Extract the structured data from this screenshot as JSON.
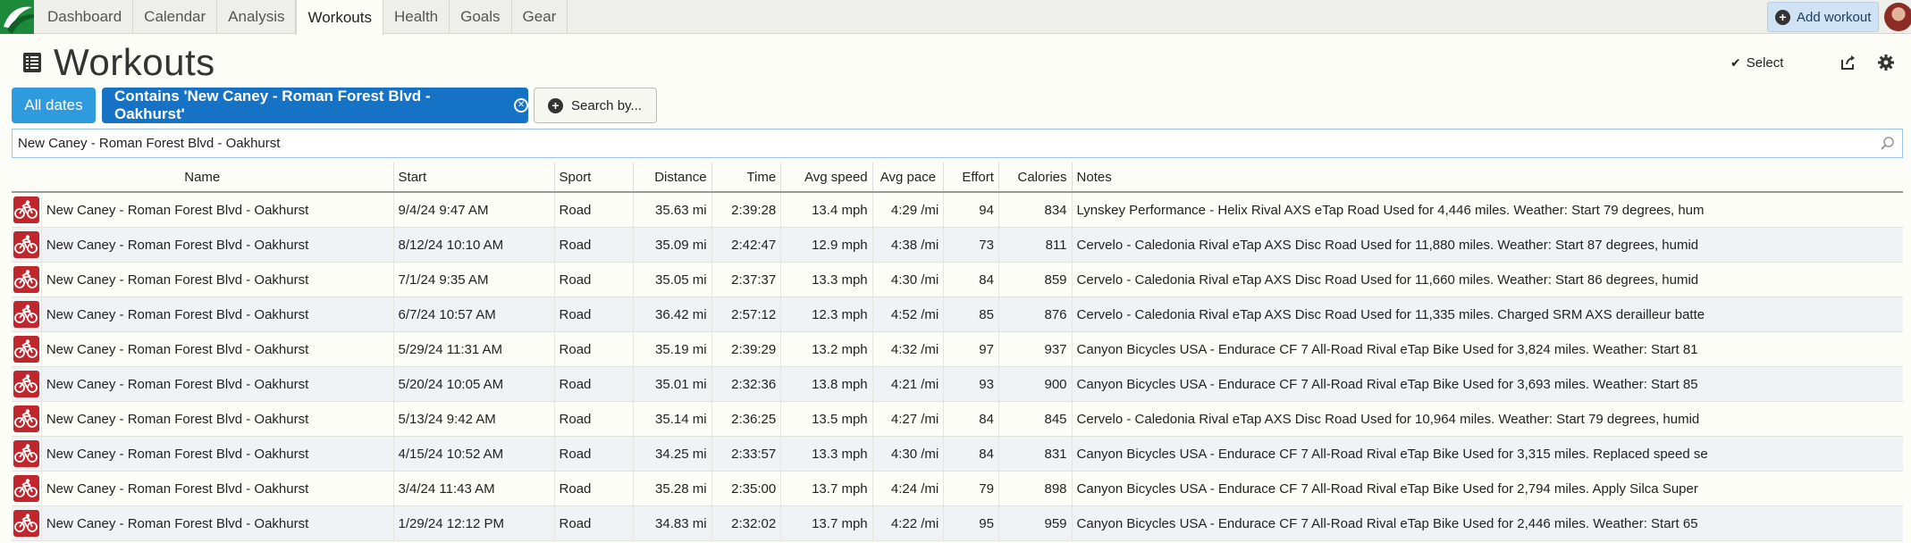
{
  "nav": {
    "tabs": [
      {
        "label": "Dashboard"
      },
      {
        "label": "Calendar"
      },
      {
        "label": "Analysis"
      },
      {
        "label": "Workouts"
      },
      {
        "label": "Health"
      },
      {
        "label": "Goals"
      },
      {
        "label": "Gear"
      }
    ],
    "active_tab": "Workouts",
    "add_workout_label": "Add workout"
  },
  "page": {
    "title": "Workouts",
    "select_label": "Select"
  },
  "filters": {
    "dates_label": "All dates",
    "contains_label": "Contains 'New Caney - Roman Forest Blvd - Oakhurst'",
    "search_by_label": "Search by..."
  },
  "search": {
    "value": "New Caney - Roman Forest Blvd - Oakhurst"
  },
  "table": {
    "headers": {
      "name": "Name",
      "start": "Start",
      "sport": "Sport",
      "distance": "Distance",
      "time": "Time",
      "avg_speed": "Avg speed",
      "avg_pace": "Avg pace",
      "effort": "Effort",
      "calories": "Calories",
      "notes": "Notes"
    },
    "rows": [
      {
        "name": "New Caney - Roman Forest Blvd - Oakhurst",
        "start": "9/4/24 9:47 AM",
        "sport": "Road",
        "distance": "35.63 mi",
        "time": "2:39:28",
        "avg_speed": "13.4 mph",
        "avg_pace": "4:29 /mi",
        "effort": "94",
        "calories": "834",
        "notes": "Lynskey Performance - Helix Rival AXS eTap Road Used for 4,446 miles. Weather: Start 79 degrees, hum"
      },
      {
        "name": "New Caney - Roman Forest Blvd - Oakhurst",
        "start": "8/12/24 10:10 AM",
        "sport": "Road",
        "distance": "35.09 mi",
        "time": "2:42:47",
        "avg_speed": "12.9 mph",
        "avg_pace": "4:38 /mi",
        "effort": "73",
        "calories": "811",
        "notes": "Cervelo - Caledonia Rival eTap AXS Disc Road Used for 11,880 miles. Weather: Start 87 degrees, humid"
      },
      {
        "name": "New Caney - Roman Forest Blvd - Oakhurst",
        "start": "7/1/24 9:35 AM",
        "sport": "Road",
        "distance": "35.05 mi",
        "time": "2:37:37",
        "avg_speed": "13.3 mph",
        "avg_pace": "4:30 /mi",
        "effort": "84",
        "calories": "859",
        "notes": "Cervelo - Caledonia Rival eTap AXS Disc Road Used for 11,660 miles. Weather: Start 86 degrees, humid"
      },
      {
        "name": "New Caney - Roman Forest Blvd - Oakhurst",
        "start": "6/7/24 10:57 AM",
        "sport": "Road",
        "distance": "36.42 mi",
        "time": "2:57:12",
        "avg_speed": "12.3 mph",
        "avg_pace": "4:52 /mi",
        "effort": "85",
        "calories": "876",
        "notes": "Cervelo - Caledonia Rival eTap AXS Disc Road Used for 11,335 miles. Charged SRM AXS derailleur batte"
      },
      {
        "name": "New Caney - Roman Forest Blvd - Oakhurst",
        "start": "5/29/24 11:31 AM",
        "sport": "Road",
        "distance": "35.19 mi",
        "time": "2:39:29",
        "avg_speed": "13.2 mph",
        "avg_pace": "4:32 /mi",
        "effort": "97",
        "calories": "937",
        "notes": "Canyon Bicycles USA - Endurace CF 7 All-Road Rival eTap Bike Used for 3,824 miles. Weather: Start 81"
      },
      {
        "name": "New Caney - Roman Forest Blvd - Oakhurst",
        "start": "5/20/24 10:05 AM",
        "sport": "Road",
        "distance": "35.01 mi",
        "time": "2:32:36",
        "avg_speed": "13.8 mph",
        "avg_pace": "4:21 /mi",
        "effort": "93",
        "calories": "900",
        "notes": "Canyon Bicycles USA - Endurace CF 7 All-Road Rival eTap Bike Used for 3,693 miles. Weather: Start 85"
      },
      {
        "name": "New Caney - Roman Forest Blvd - Oakhurst",
        "start": "5/13/24 9:42 AM",
        "sport": "Road",
        "distance": "35.14 mi",
        "time": "2:36:25",
        "avg_speed": "13.5 mph",
        "avg_pace": "4:27 /mi",
        "effort": "84",
        "calories": "845",
        "notes": "Cervelo - Caledonia Rival eTap AXS Disc Road Used for 10,964 miles. Weather: Start 79 degrees, humid"
      },
      {
        "name": "New Caney - Roman Forest Blvd - Oakhurst",
        "start": "4/15/24 10:52 AM",
        "sport": "Road",
        "distance": "34.25 mi",
        "time": "2:33:57",
        "avg_speed": "13.3 mph",
        "avg_pace": "4:30 /mi",
        "effort": "84",
        "calories": "831",
        "notes": "Canyon Bicycles USA - Endurace CF 7 All-Road Rival eTap Bike Used for 3,315 miles. Replaced speed se"
      },
      {
        "name": "New Caney - Roman Forest Blvd - Oakhurst",
        "start": "3/4/24 11:43 AM",
        "sport": "Road",
        "distance": "35.28 mi",
        "time": "2:35:00",
        "avg_speed": "13.7 mph",
        "avg_pace": "4:24 /mi",
        "effort": "79",
        "calories": "898",
        "notes": "Canyon Bicycles USA - Endurace CF 7 All-Road Rival eTap Bike Used for 2,794 miles. Apply Silca Super"
      },
      {
        "name": "New Caney - Roman Forest Blvd - Oakhurst",
        "start": "1/29/24 12:12 PM",
        "sport": "Road",
        "distance": "34.83 mi",
        "time": "2:32:02",
        "avg_speed": "13.7 mph",
        "avg_pace": "4:22 /mi",
        "effort": "95",
        "calories": "959",
        "notes": "Canyon Bicycles USA - Endurace CF 7 All-Road Rival eTap Bike Used for 2,446 miles. Weather: Start 65"
      }
    ]
  },
  "icons": {
    "row_icon": "road-bike-icon",
    "logo": "app-logo"
  },
  "colors": {
    "accent_blue": "#2e9bde",
    "filter_blue": "#1572c4",
    "sport_red": "#c0262b",
    "logo_green": "#1c8a3a"
  }
}
